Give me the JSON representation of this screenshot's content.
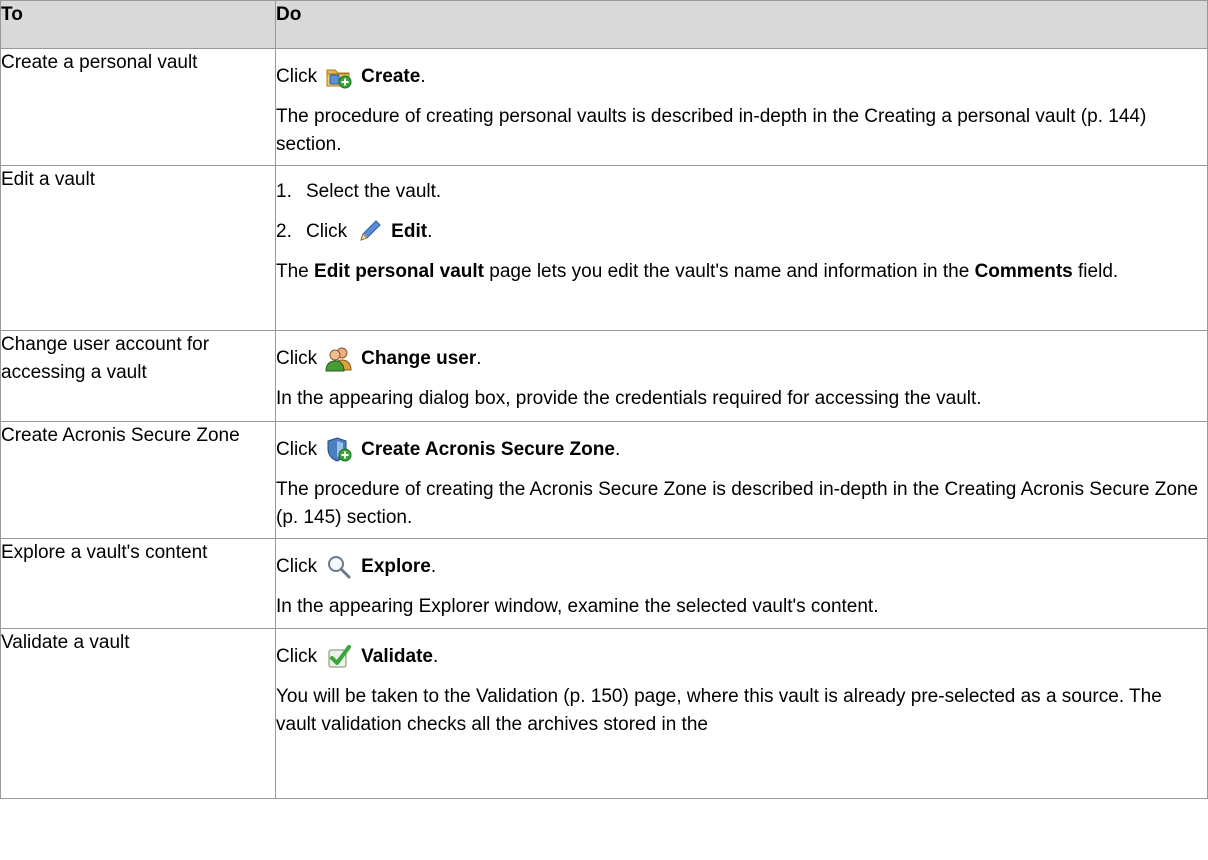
{
  "header": {
    "col_to": "To",
    "col_do": "Do"
  },
  "rows": [
    {
      "to": "Create a personal vault",
      "click": "Click",
      "icon": "folder-add-icon",
      "action": "Create",
      "desc": "The procedure of creating personal vaults is described in-depth in the Creating a personal vault (p. 144) section."
    },
    {
      "to": "Edit a vault",
      "step1_num": "1.",
      "step1": "Select the vault.",
      "step2_num": "2.",
      "click": "Click",
      "icon": "pencil-icon",
      "action": "Edit",
      "desc_pre": "The ",
      "desc_b1": "Edit personal vault",
      "desc_mid": " page lets you edit the vault's name and information in the ",
      "desc_b2": "Comments",
      "desc_post": " field."
    },
    {
      "to": "Change user account for accessing a vault",
      "click": "Click",
      "icon": "users-icon",
      "action": "Change user",
      "desc": "In the appearing dialog box, provide the credentials required for accessing the vault."
    },
    {
      "to": "Create Acronis Secure Zone",
      "click": "Click",
      "icon": "shield-add-icon",
      "action": "Create Acronis Secure Zone",
      "desc": "The procedure of creating the Acronis Secure Zone is described in-depth in the Creating Acronis Secure Zone (p. 145) section."
    },
    {
      "to": "Explore a vault's content",
      "click": "Click",
      "icon": "magnifier-icon",
      "action": "Explore",
      "desc": "In the appearing Explorer window, examine the selected vault's content."
    },
    {
      "to": "Validate a vault",
      "click": "Click",
      "icon": "checkmark-icon",
      "action": "Validate",
      "desc": "You will be taken to the Validation (p. 150) page, where this vault is already pre-selected as a source. The vault validation checks all the archives stored in the"
    }
  ],
  "period": "."
}
